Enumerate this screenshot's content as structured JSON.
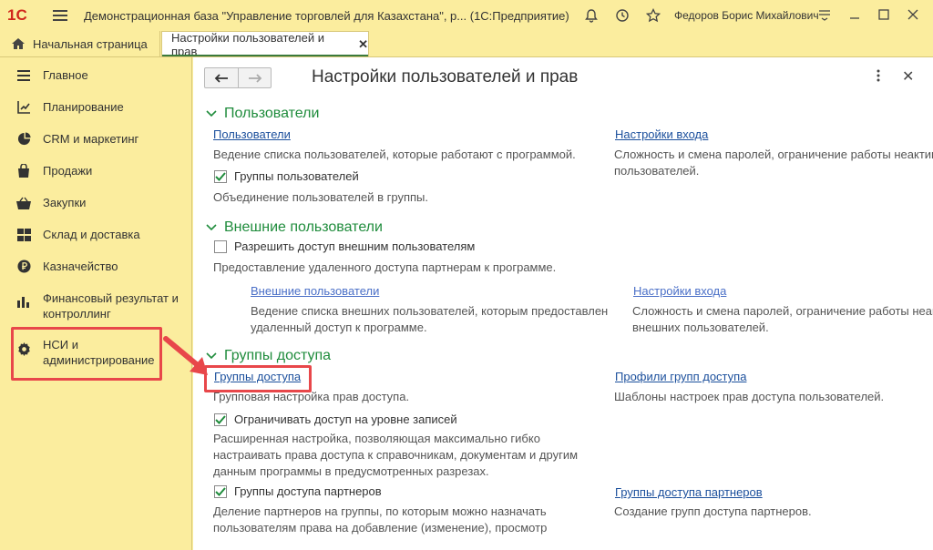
{
  "titlebar": {
    "logo": "1С",
    "title": "Демонстрационная база \"Управление торговлей для Казахстана\", р...  (1С:Предприятие)",
    "user": "Федоров Борис Михайлович"
  },
  "tabs": {
    "home": "Начальная страница",
    "active": "Настройки пользователей и прав"
  },
  "sidebar": {
    "items": [
      {
        "label": "Главное",
        "icon": "menu-icon"
      },
      {
        "label": "Планирование",
        "icon": "planning-icon"
      },
      {
        "label": "CRM и маркетинг",
        "icon": "pie-chart-icon"
      },
      {
        "label": "Продажи",
        "icon": "shopping-bag-icon"
      },
      {
        "label": "Закупки",
        "icon": "basket-icon"
      },
      {
        "label": "Склад и доставка",
        "icon": "warehouse-icon"
      },
      {
        "label": "Казначейство",
        "icon": "coin-icon"
      },
      {
        "label": "Финансовый результат и контроллинг",
        "icon": "bar-chart-icon"
      },
      {
        "label": "НСИ и администрирование",
        "icon": "gear-icon"
      }
    ]
  },
  "main": {
    "title": "Настройки пользователей и прав",
    "sections": {
      "users": {
        "title": "Пользователи",
        "users_link": "Пользователи",
        "users_desc": "Ведение списка пользователей, которые работают с программой.",
        "login_link": "Настройки входа",
        "login_desc_1": "Сложность и смена паролей, ограничение работы неактив",
        "login_desc_2": "пользователей.",
        "groups_chk": "Группы пользователей",
        "groups_desc": "Объединение пользователей в группы."
      },
      "external": {
        "title": "Внешние пользователи",
        "allow_chk": "Разрешить доступ внешним пользователям",
        "allow_desc": "Предоставление удаленного доступа партнерам к программе.",
        "ext_link": "Внешние пользователи",
        "ext_desc_1": "Ведение списка внешних пользователей, которым предоставлен",
        "ext_desc_2": "удаленный доступ к программе.",
        "ext_login_link": "Настройки входа",
        "ext_login_desc_1": "Сложность и смена паролей, ограничение работы неакт",
        "ext_login_desc_2": "внешних пользователей."
      },
      "access": {
        "title": "Группы доступа",
        "groups_link": "Группы доступа",
        "groups_desc": "Групповая настройка прав доступа.",
        "profiles_link": "Профили групп доступа",
        "profiles_desc": "Шаблоны настроек прав доступа пользователей.",
        "rls_chk": "Ограничивать доступ на уровне записей",
        "rls_desc_1": "Расширенная настройка, позволяющая максимально гибко",
        "rls_desc_2": "настраивать права доступа к справочникам, документам и другим",
        "rls_desc_3": "данным программы в предусмотренных разрезах.",
        "partners_chk": "Группы доступа партнеров",
        "partners_desc_1": "Деление партнеров на группы, по которым можно назначать",
        "partners_desc_2": "пользователям права на добавление (изменение), просмотр",
        "partners_link": "Группы доступа партнеров",
        "partners_link_desc": "Создание групп доступа партнеров."
      }
    }
  },
  "checkboxes": {
    "groups": true,
    "allow_external": false,
    "rls": true,
    "partners": true
  },
  "colors": {
    "accent_green": "#1f8c3c",
    "link_blue": "#1b4f9c",
    "highlight_red": "#e8474a",
    "panel_yellow": "#fbed9e"
  }
}
